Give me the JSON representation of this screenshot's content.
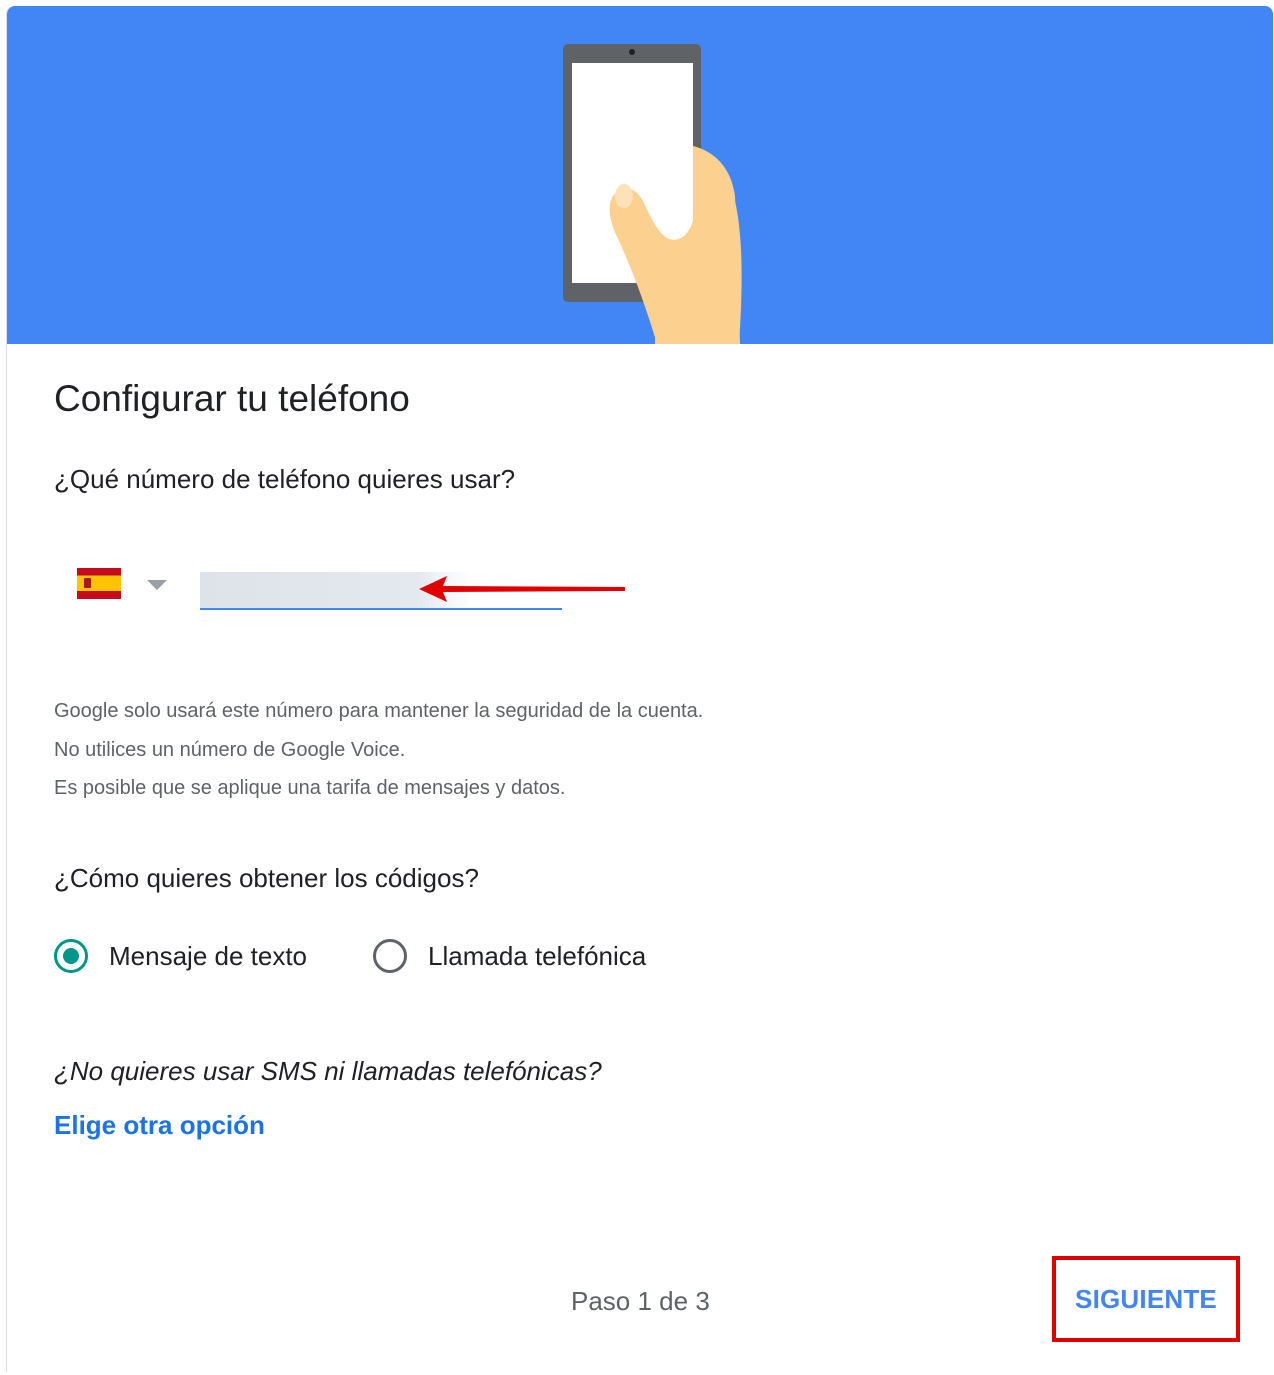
{
  "header": {
    "illustration": "hand-holding-phone-illustration",
    "background_color": "#4285f4"
  },
  "page": {
    "title": "Configurar tu teléfono",
    "phone_question": "¿Qué número de teléfono quieres usar?"
  },
  "phone": {
    "country_flag": "spain-flag-icon",
    "dropdown_icon": "caret-down-icon",
    "number_value": "",
    "annotation": "red-arrow-pointing-left"
  },
  "info_lines": [
    "Google solo usará este número para mantener la seguridad de la cuenta.",
    "No utilices un número de Google Voice.",
    "Es posible que se aplique una tarifa de mensajes y datos."
  ],
  "codes": {
    "question": "¿Cómo quieres obtener los códigos?",
    "options": [
      {
        "label": "Mensaje de texto",
        "selected": true
      },
      {
        "label": "Llamada telefónica",
        "selected": false
      }
    ],
    "accent_color": "#009688"
  },
  "alternative": {
    "question": "¿No quieres usar SMS ni llamadas telefónicas?",
    "link_label": "Elige otra opción"
  },
  "footer": {
    "step": "Paso 1 de 3",
    "next_label": "SIGUIENTE",
    "highlight_color": "#e00000"
  }
}
